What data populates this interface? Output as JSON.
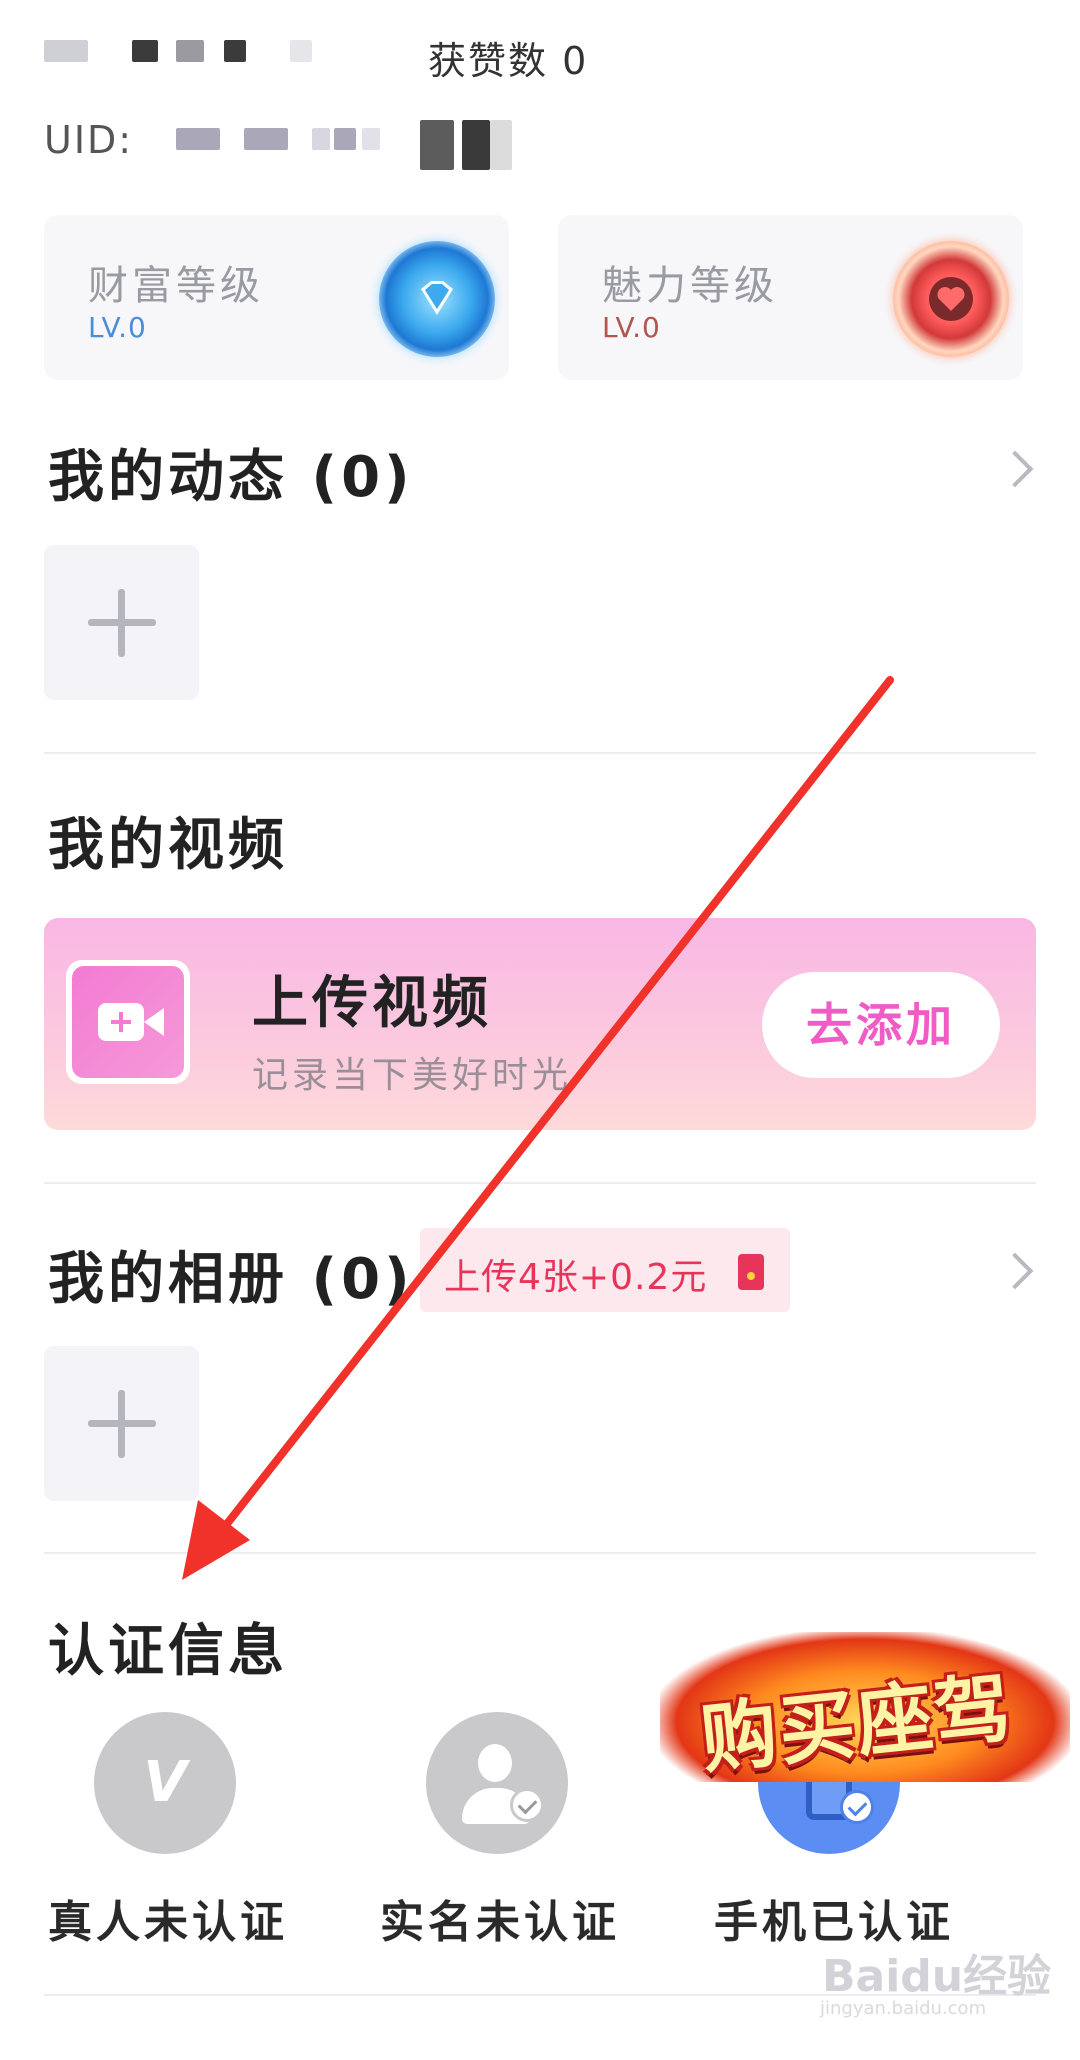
{
  "header": {
    "likes_label": "获赞数 0",
    "uid_label": "UID:"
  },
  "levels": [
    {
      "title": "财富等级",
      "level": "LV.0",
      "color": "#4a8fd6",
      "badge_icon": "diamond-badge-icon"
    },
    {
      "title": "魅力等级",
      "level": "LV.0",
      "color": "#b0564f",
      "badge_icon": "heart-badge-icon"
    }
  ],
  "posts": {
    "title": "我的动态 (0)"
  },
  "videos": {
    "title": "我的视频",
    "banner_title": "上传视频",
    "banner_subtitle": "记录当下美好时光",
    "add_button": "去添加"
  },
  "album": {
    "title": "我的相册 (0)",
    "reward_text": "上传4张+0.2元"
  },
  "certification": {
    "title": "认证信息",
    "items": [
      {
        "label": "真人未认证",
        "icon": "verified-v-icon",
        "status_color": "#c9c9cc"
      },
      {
        "label": "实名未认证",
        "icon": "id-person-icon",
        "status_color": "#c9c9cc"
      },
      {
        "label": "手机已认证",
        "icon": "phone-check-icon",
        "status_color": "#5b8df2"
      }
    ]
  },
  "promo": {
    "text": "购买座驾"
  },
  "watermark": {
    "brand": "Baidu经验",
    "url": "jingyan.baidu.com"
  },
  "colors": {
    "accent_pink": "#f05cc6",
    "reward_red": "#e8345a",
    "annotation_arrow": "#f0322a"
  }
}
